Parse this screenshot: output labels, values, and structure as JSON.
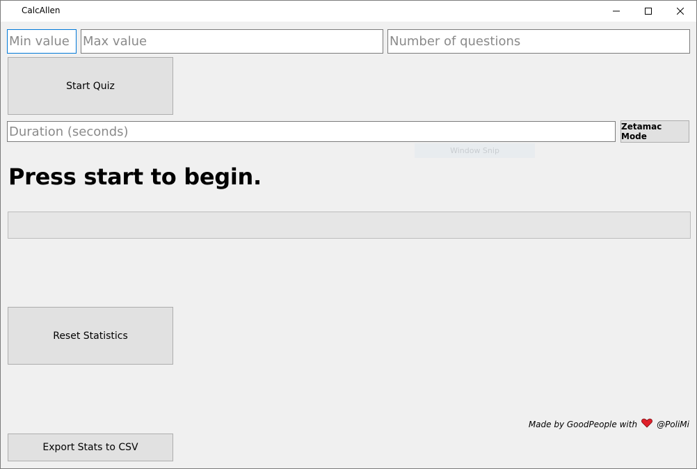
{
  "window": {
    "title": "CalcAllen"
  },
  "inputs": {
    "min_value": {
      "value": "",
      "placeholder": "Min value"
    },
    "max_value": {
      "value": "",
      "placeholder": "Max value"
    },
    "num_questions": {
      "value": "",
      "placeholder": "Number of questions"
    },
    "duration": {
      "value": "",
      "placeholder": "Duration (seconds)"
    }
  },
  "buttons": {
    "start_quiz": "Start Quiz",
    "zetamac_mode": "Zetamac Mode",
    "reset_statistics": "Reset Statistics",
    "export_stats": "Export Stats to CSV"
  },
  "status": {
    "message": "Press start to begin.",
    "progress": 0
  },
  "overlay": {
    "ghost_label": "Window Snip"
  },
  "footer": {
    "credit_prefix": "Made by GoodPeople with",
    "credit_suffix": "@PoliMi"
  },
  "icons": {
    "heart": "heart-icon",
    "minimize": "minimize-icon",
    "maximize": "maximize-icon",
    "close": "close-icon"
  },
  "colors": {
    "focus_border": "#0078d7",
    "heart": "#e0202a",
    "button_bg": "#e1e1e1",
    "window_bg": "#f0f0f0"
  }
}
